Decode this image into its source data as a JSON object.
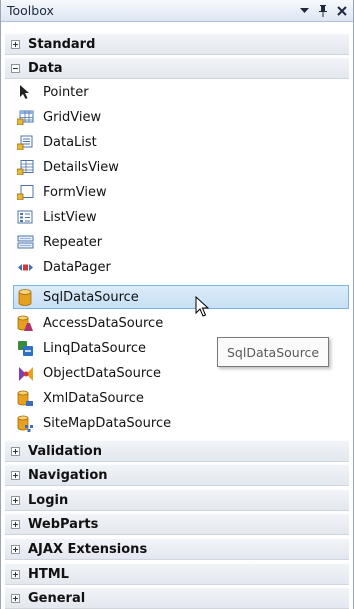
{
  "window": {
    "title": "Toolbox"
  },
  "categories": {
    "standard": "Standard",
    "data": "Data",
    "validation": "Validation",
    "navigation": "Navigation",
    "login": "Login",
    "webparts": "WebParts",
    "ajax": "AJAX Extensions",
    "html": "HTML",
    "general": "General"
  },
  "data_items": [
    {
      "label": "Pointer",
      "icon": "pointer-icon"
    },
    {
      "label": "GridView",
      "icon": "gridview-icon"
    },
    {
      "label": "DataList",
      "icon": "datalist-icon"
    },
    {
      "label": "DetailsView",
      "icon": "detailsview-icon"
    },
    {
      "label": "FormView",
      "icon": "formview-icon"
    },
    {
      "label": "ListView",
      "icon": "listview-icon"
    },
    {
      "label": "Repeater",
      "icon": "repeater-icon"
    },
    {
      "label": "DataPager",
      "icon": "datapager-icon"
    },
    {
      "label": "SqlDataSource",
      "icon": "sqldatasource-icon",
      "selected": true
    },
    {
      "label": "AccessDataSource",
      "icon": "accessdatasource-icon"
    },
    {
      "label": "LinqDataSource",
      "icon": "linqdatasource-icon"
    },
    {
      "label": "ObjectDataSource",
      "icon": "objectdatasource-icon"
    },
    {
      "label": "XmlDataSource",
      "icon": "xmldatasource-icon"
    },
    {
      "label": "SiteMapDataSource",
      "icon": "sitemapdatasource-icon"
    }
  ],
  "tooltip": {
    "text": "SqlDataSource"
  },
  "colors": {
    "selection": "#c7e0f5",
    "selection_border": "#7fb4dd",
    "header": "#e3e8ef"
  }
}
